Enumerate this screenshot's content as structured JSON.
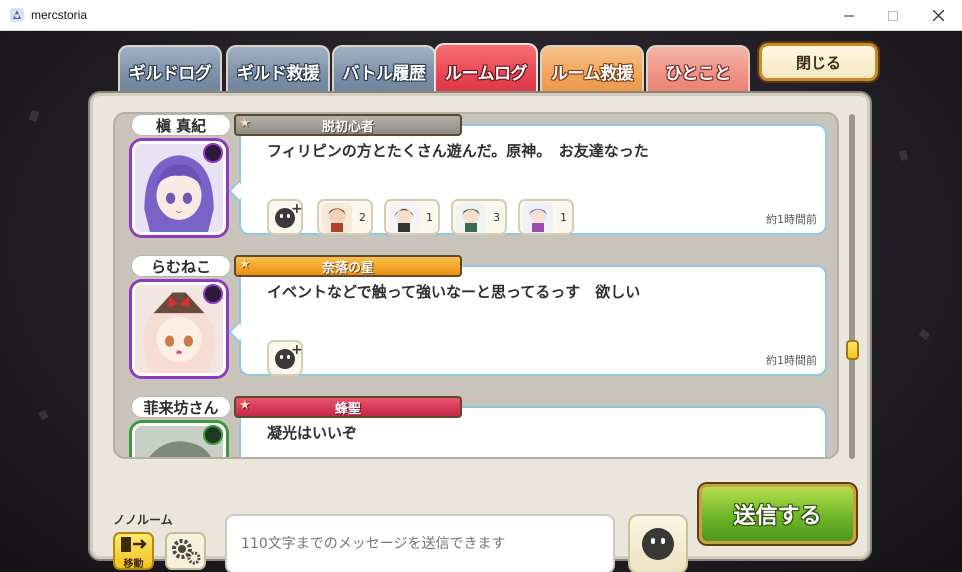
{
  "window": {
    "title": "mercstoria"
  },
  "tabs": [
    {
      "label": "ギルドログ",
      "active": false
    },
    {
      "label": "ギルド救援",
      "active": false
    },
    {
      "label": "バトル履歴",
      "active": false
    },
    {
      "label": "ルームログ",
      "active": true
    },
    {
      "label": "ルーム救援",
      "active": false
    },
    {
      "label": "ひとこと",
      "active": false
    }
  ],
  "close_label": "閉じる",
  "entries": [
    {
      "name": "槇 真紀",
      "title": "脱初心者",
      "message": "フィリピンの方とたくさん遊んだ。原神。　お友達なった",
      "time": "約1時間前",
      "reactions": [
        {
          "icon": "chibi-reaction-icon",
          "count": "2"
        },
        {
          "icon": "chibi-reaction-icon",
          "count": "1"
        },
        {
          "icon": "chibi-reaction-icon",
          "count": "3"
        },
        {
          "icon": "chibi-reaction-icon",
          "count": "1"
        }
      ]
    },
    {
      "name": "らむねこ",
      "title": "奈落の星",
      "message": "イベントなどで触って強いなーと思ってるっす　欲しい",
      "time": "約1時間前",
      "reactions": []
    },
    {
      "name": "菲来坊さん",
      "title": "蜂聖",
      "message": "凝光はいいぞ",
      "time": "",
      "reactions": []
    }
  ],
  "footer": {
    "room_name": "ノノルーム",
    "move_label": "移動",
    "input_placeholder": "110文字までのメッセージを送信できます",
    "send_label": "送信する"
  }
}
